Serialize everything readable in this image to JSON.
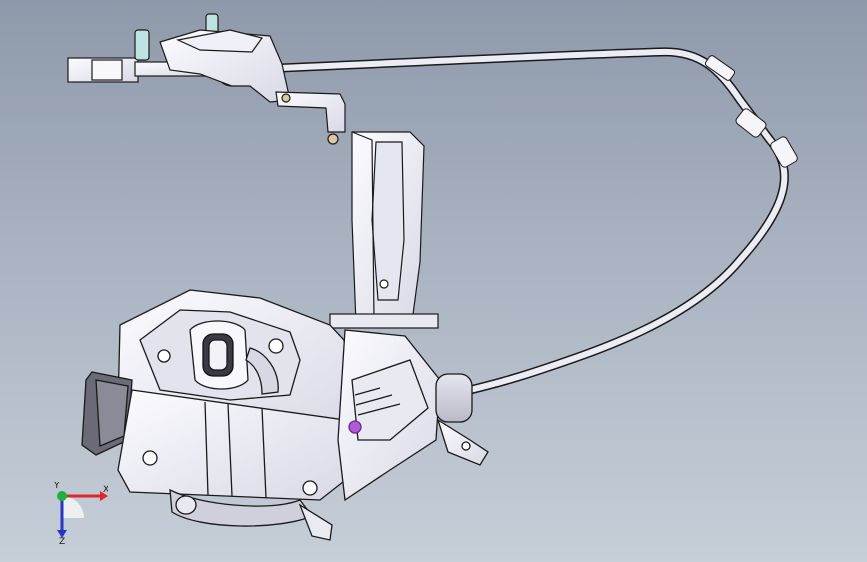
{
  "viewport": {
    "background_top": "#8e99aa",
    "background_bottom": "#c6ced8",
    "part_fill": "#f2f2f7",
    "part_stroke": "#1a1a1a",
    "highlight": "#b45ad8"
  },
  "triad": {
    "x_label": "X",
    "y_label": "Y",
    "z_label": "Z",
    "x_color": "#e0262a",
    "y_color": "#1db23a",
    "z_color": "#2536c8"
  }
}
